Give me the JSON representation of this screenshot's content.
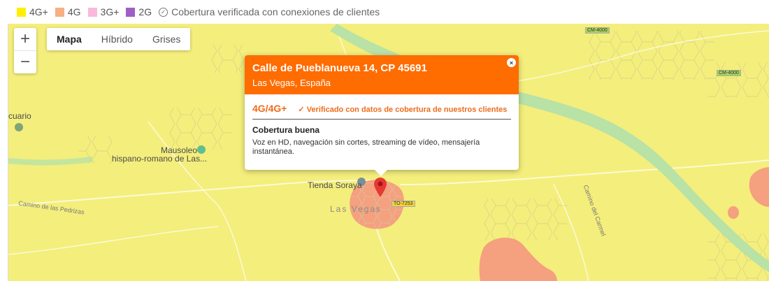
{
  "legend": {
    "items": [
      {
        "label": "4G+",
        "color": "#ffef00"
      },
      {
        "label": "4G",
        "color": "#f6b084"
      },
      {
        "label": "3G+",
        "color": "#f8b9dc"
      },
      {
        "label": "2G",
        "color": "#9e60c6"
      }
    ],
    "verified_label": "Cobertura verificada con conexiones de clientes",
    "verified_icon": "check-circle-icon"
  },
  "map": {
    "zoom_in": "+",
    "zoom_out": "−",
    "types": [
      "Mapa",
      "Híbrido",
      "Grises"
    ],
    "active_type": "Mapa",
    "colors": {
      "coverage_4g_plus": "#f4ee7c",
      "coverage_4g": "#f5a07e",
      "river": "#b8e2a6",
      "pin": "#e53935"
    },
    "labels": {
      "poi_left": "cuario",
      "mausoleo_line1": "Mausoleo",
      "mausoleo_line2": "hispano-romano de Las...",
      "tienda": "Tienda Soraya",
      "town": "Las Vegas",
      "road_tag_1": "CM-4000",
      "road_tag_2": "CM-4000",
      "road_tag_3": "TO-7253",
      "street_1": "Camino de las Pedrizas",
      "street_2": "Camino del Carmel"
    }
  },
  "popup": {
    "title": "Calle de Pueblanueva 14, CP 45691",
    "subtitle": "Las Vegas, España",
    "close": "×",
    "technology": "4G/4G+",
    "verified": "✓ Verificado con datos de cobertura de nuestros clientes",
    "quality": "Cobertura buena",
    "description": "Voz en HD, navegación sin cortes, streaming de vídeo, mensajería instantánea.",
    "accent_color": "#ff6c00"
  }
}
